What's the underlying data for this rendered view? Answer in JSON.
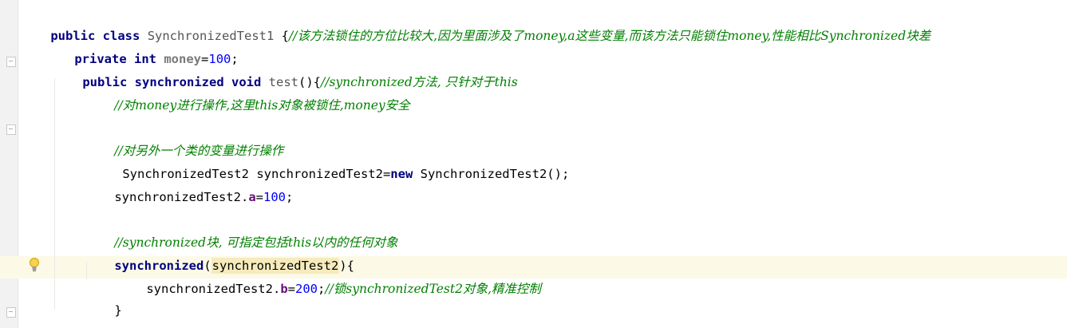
{
  "code": {
    "line1": {
      "kw_public": "public",
      "kw_class": "class",
      "class_name": "SynchronizedTest1",
      "brace": "{",
      "comment": "//该方法锁住的方位比较大,因为里面涉及了money,a这些变量,而该方法只能锁住money,性能相比Synchronized块差"
    },
    "line2": {
      "kw_private": "private",
      "kw_int": "int",
      "field": "money",
      "assign": "=",
      "value": "100",
      "semi": ";"
    },
    "line3": {
      "kw_public": "public",
      "kw_synchronized": "synchronized",
      "kw_void": "void",
      "method": "test",
      "sig": "(){",
      "comment": "//synchronized方法, 只针对于this"
    },
    "line4": {
      "comment": "//对money进行操作,这里this对象被锁住,money安全"
    },
    "line6": {
      "comment": "//对另外一个类的变量进行操作"
    },
    "line7": {
      "type": "SynchronizedTest2",
      "var": "synchronizedTest2",
      "assign": "=",
      "kw_new": "new",
      "ctor": "SynchronizedTest2",
      "tail": "();"
    },
    "line8": {
      "obj": "synchronizedTest2.",
      "field": "a",
      "assign": "=",
      "value": "100",
      "semi": ";"
    },
    "line10": {
      "comment": "//synchronized块, 可指定包括this以内的任何对象"
    },
    "line11": {
      "kw_synchronized": "synchronized",
      "open": "(",
      "arg": "synchronizedTest2",
      "close": "){"
    },
    "line12": {
      "obj": "synchronizedTest2.",
      "field": "b",
      "assign": "=",
      "value": "200",
      "semi": ";",
      "comment": "//锁synchronizedTest2对象,精准控制"
    },
    "line13": {
      "brace": "}"
    },
    "line14": {
      "brace": "}"
    }
  },
  "icons": {
    "gutter_fold": "fold-marker-icon",
    "intention": "lightbulb-icon"
  },
  "colors": {
    "keyword": "#000080",
    "number": "#0000ff",
    "field": "#660e7a",
    "comment": "#008000",
    "current_line": "#fcfae6",
    "usage_highlight": "#f6ebbc"
  }
}
